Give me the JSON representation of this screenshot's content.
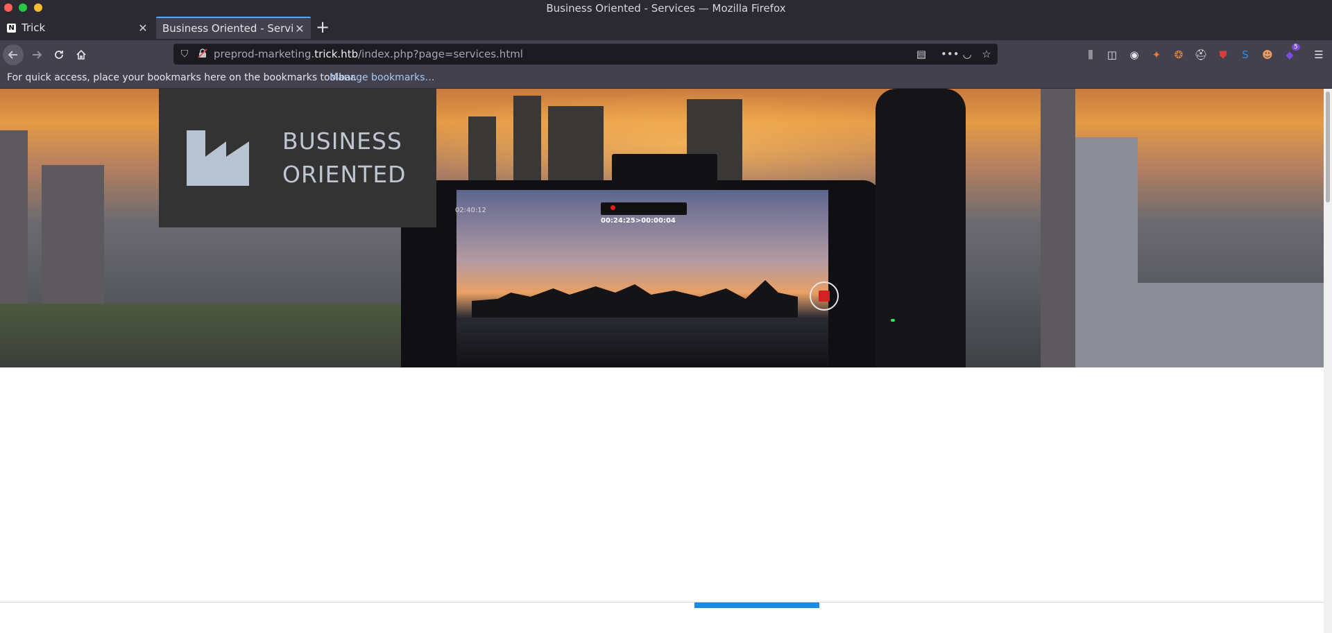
{
  "window": {
    "title": "Business Oriented - Services — Mozilla Firefox"
  },
  "tabs": [
    {
      "label": "Trick",
      "icon": "notion-icon",
      "active": false
    },
    {
      "label": "Business Oriented - Services",
      "icon": "none",
      "active": true
    }
  ],
  "urlbar": {
    "prefix": "preprod-marketing.",
    "host": "trick.htb",
    "path": "/index.php?page=services.html"
  },
  "bookmarks_bar": {
    "message": "For quick access, place your bookmarks here on the bookmarks toolbar.",
    "manage_link": "Manage bookmarks…"
  },
  "page": {
    "logo_line1": "BUSINESS",
    "logo_line2": "ORIENTED",
    "hero": {
      "timecode": "02:40:12",
      "recording": "00:24:25>00:00:04"
    }
  },
  "extensions": {
    "badge_count": "5"
  },
  "colors": {
    "accent": "#1d8ce0",
    "tab_highlight": "#54a8ff",
    "logo_box": "#333333",
    "logo_fg": "#bfc6d1"
  }
}
